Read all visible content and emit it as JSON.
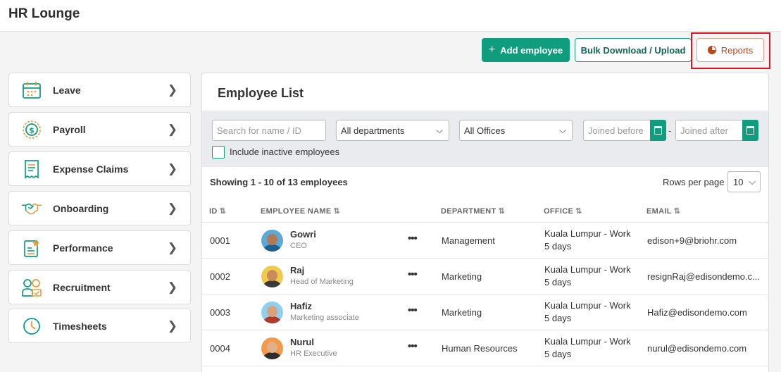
{
  "app": {
    "title": "HR Lounge"
  },
  "actions": {
    "add_employee": "Add employee",
    "bulk": "Bulk Download / Upload",
    "reports": "Reports"
  },
  "sidebar": {
    "items": [
      {
        "label": "Leave",
        "icon": "calendar-icon"
      },
      {
        "label": "Payroll",
        "icon": "payroll-icon"
      },
      {
        "label": "Expense Claims",
        "icon": "receipt-icon"
      },
      {
        "label": "Onboarding",
        "icon": "handshake-icon"
      },
      {
        "label": "Performance",
        "icon": "performance-icon"
      },
      {
        "label": "Recruitment",
        "icon": "recruitment-icon"
      },
      {
        "label": "Timesheets",
        "icon": "clock-icon"
      }
    ]
  },
  "list": {
    "title": "Employee List",
    "search_placeholder": "Search for name / ID",
    "department_value": "All departments",
    "office_value": "All Offices",
    "joined_before_placeholder": "Joined before",
    "joined_after_placeholder": "Joined after",
    "date_separator": "-",
    "include_inactive": "Include inactive employees",
    "showing": "Showing 1 - 10 of 13 employees",
    "rows_per_page_label": "Rows per page",
    "rows_per_page_value": "10",
    "columns": [
      "ID",
      "EMPLOYEE NAME",
      "DEPARTMENT",
      "OFFICE",
      "EMAIL"
    ],
    "rows": [
      {
        "id": "0001",
        "name": "Gowri",
        "role": "CEO",
        "dept": "Management",
        "office_l1": "Kuala Lumpur - Work",
        "office_l2": "5 days",
        "email": "edison+9@briohr.com"
      },
      {
        "id": "0002",
        "name": "Raj",
        "role": "Head of Marketing",
        "dept": "Marketing",
        "office_l1": "Kuala Lumpur - Work",
        "office_l2": "5 days",
        "email": "resignRaj@edisondemo.c..."
      },
      {
        "id": "0003",
        "name": "Hafiz",
        "role": "Marketing associate",
        "dept": "Marketing",
        "office_l1": "Kuala Lumpur - Work",
        "office_l2": "5 days",
        "email": "Hafiz@edisondemo.com"
      },
      {
        "id": "0004",
        "name": "Nurul",
        "role": "HR Executive",
        "dept": "Human Resources",
        "office_l1": "Kuala Lumpur - Work",
        "office_l2": "5 days",
        "email": "nurul@edisondemo.com"
      }
    ],
    "more_icon": "more-dots-icon"
  },
  "colors": {
    "accent": "#0f9d7e",
    "reports": "#c0451b",
    "highlight": "#e0141d"
  }
}
